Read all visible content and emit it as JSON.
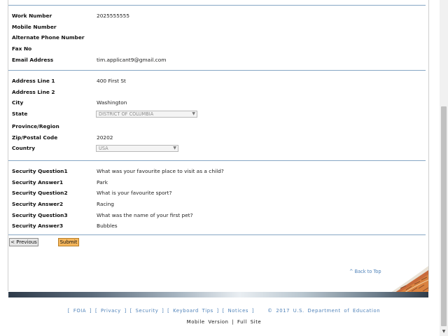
{
  "contact": {
    "work_number_label": "Work Number",
    "work_number_value": "2025555555",
    "mobile_number_label": "Mobile Number",
    "alt_phone_label": "Alternate Phone Number",
    "fax_label": "Fax No",
    "email_label": "Email Address",
    "email_value": "tim.applicant9@gmail.com"
  },
  "address": {
    "line1_label": "Address Line 1",
    "line1_value": "400 First St",
    "line2_label": "Address Line 2",
    "city_label": "City",
    "city_value": "Washington",
    "state_label": "State",
    "state_value": "DISTRICT OF COLUMBIA",
    "province_label": "Province/Region",
    "zip_label": "Zip/Postal Code",
    "zip_value": "20202",
    "country_label": "Country",
    "country_value": "USA"
  },
  "security": {
    "q1_label": "Security Question1",
    "q1_value": "What was your favourite place to visit as a child?",
    "a1_label": "Security Answer1",
    "a1_value": "Park",
    "q2_label": "Security Question2",
    "q2_value": "What is your favourite sport?",
    "a2_label": "Security Answer2",
    "a2_value": "Racing",
    "q3_label": "Security Question3",
    "q3_value": "What was the name of your first pet?",
    "a3_label": "Security Answer3",
    "a3_value": "Bubbles"
  },
  "actions": {
    "previous_label": "< Previous",
    "submit_label": "Submit"
  },
  "back_to_top": "^ Back to Top",
  "footer": {
    "lb": "[",
    "rb": "]",
    "foia": "FOIA",
    "privacy": "Privacy",
    "security": "Security",
    "keyboard_tips": "Keyboard Tips",
    "notices": "Notices",
    "copyright": "© 2017 U.S. Department of Education",
    "mobile_version": "Mobile Version",
    "separator": "|",
    "full_site": "Full Site"
  },
  "colors": {
    "accent_link": "#4f82b9",
    "submit_button": "#f6b75c",
    "divider": "#86a6c4"
  }
}
